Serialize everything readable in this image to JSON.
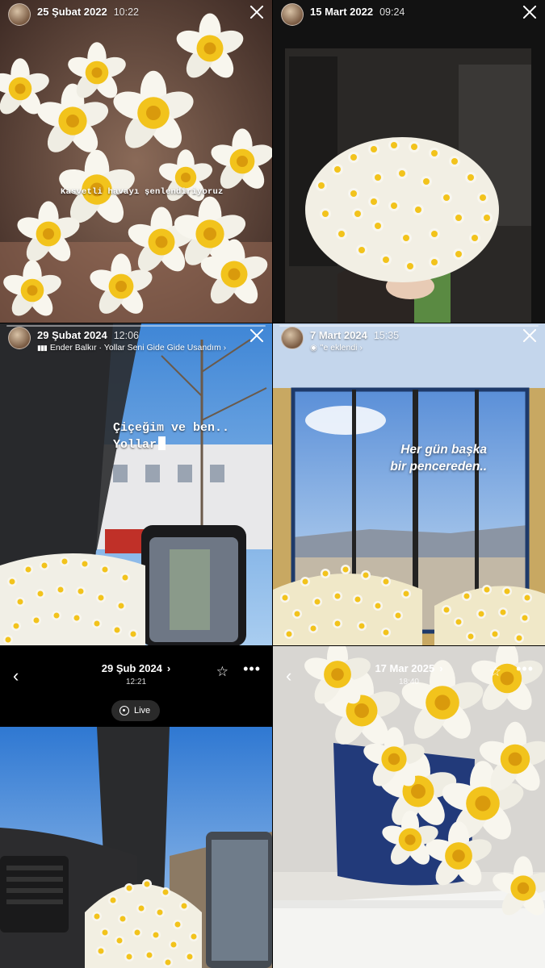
{
  "stories": [
    {
      "date": "25 Şubat 2022",
      "time": "10:22",
      "overlay": "Kasvetli havayı şenlendiriyoruz"
    },
    {
      "date": "15 Mart 2022",
      "time": "09:24"
    },
    {
      "date": "29 Şubat 2024",
      "time": "12:06",
      "music": "Ender Balkır · Yollar Seni Gide Gide Usandım ›",
      "overlay_line1": "Çiçeğim ve ben..",
      "overlay_line2": "Yollar"
    },
    {
      "date": "7 Mart 2024",
      "time": "15:35",
      "sub": "\"e eklendi ›",
      "overlay_line1": "Her gün başka",
      "overlay_line2": "bir pencereden.."
    }
  ],
  "gallery": [
    {
      "date": "29 Şub 2024",
      "time": "12:21",
      "live_label": "Live",
      "chevron": "›"
    },
    {
      "date": "17 Mar 2025",
      "time": "18:40",
      "chevron": "›"
    }
  ],
  "icons": {
    "back": "‹",
    "star": "☆",
    "more": "•••"
  },
  "colors": {
    "daffodil_yellow": "#f2c31c",
    "petal_white": "#f8f6ee",
    "sky_blue": "#4f8fd8"
  }
}
